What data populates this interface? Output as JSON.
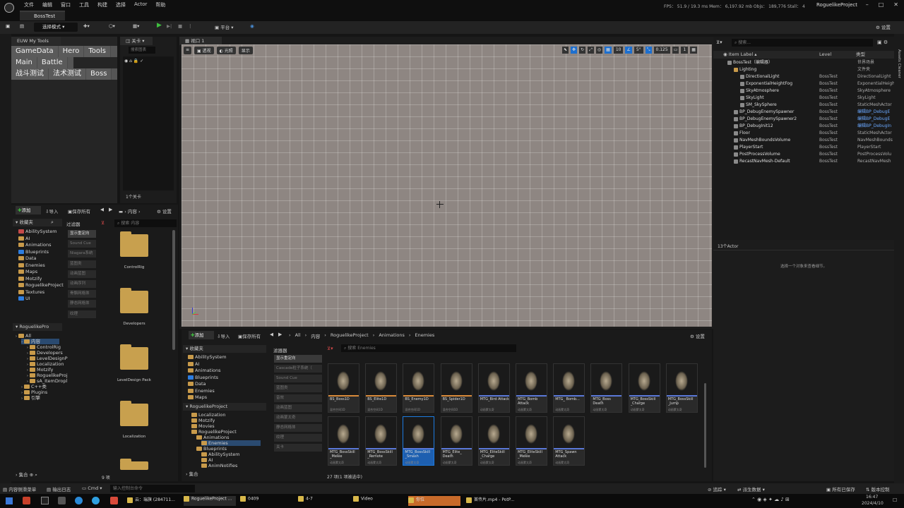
{
  "menubar": {
    "items": [
      "文件",
      "编辑",
      "窗口",
      "工具",
      "构建",
      "选择",
      "Actor",
      "帮助"
    ],
    "tab_title": "BossTest",
    "stats": "FPS： 51.9 / 19.3 ms   Mem： 6,197.92 mb   Objs： 189,776   Stall： 4",
    "project_name": "RoguelikeProject"
  },
  "toolbar": {
    "mode": "选择模式",
    "platform": "平台",
    "settings": "设置"
  },
  "euw": {
    "tab": "EUW My Tools",
    "row1": [
      "GameData",
      "Hero",
      "Tools"
    ],
    "row2": [
      "Main",
      "Battle"
    ],
    "row3": [
      "战斗测试",
      "法术测试",
      "Boss"
    ]
  },
  "layers": {
    "tab": "关卡",
    "search_placeholder": "搜索图表",
    "count": "1个关卡"
  },
  "viewport": {
    "tab": "视口 1",
    "buttons": [
      "透视",
      "光照",
      "显示"
    ],
    "snap_angle": "5°",
    "scale": "0.125",
    "cam_speed": "1",
    "grid_size": "10"
  },
  "left_cb": {
    "add": "添加",
    "import": "导入",
    "save_all": "保存所有",
    "path": "内容",
    "settings": "设置",
    "favorites": "收藏夹",
    "fav_items": [
      "AbilitySystem",
      "AI",
      "Animations",
      "Blueprints",
      "Data",
      "Enemies",
      "Maps",
      "Motzify",
      "RoguelikeProject",
      "Textures",
      "UI"
    ],
    "filter_header": "过滤器",
    "filters": [
      "显示重定向",
      "Sound Cue",
      "Niagara系统",
      "蓝图类",
      "动画蓝图",
      "动画序列",
      "骨骼网格体",
      "静态网格体",
      "纹理"
    ],
    "search_placeholder": "搜索 内容",
    "project_header": "RoguelikePro",
    "tree": [
      "All",
      "内容",
      "ControlRig",
      "Developers",
      "LevelDesignP",
      "Localization",
      "Motzify",
      "RoguelikeProj",
      "sA_ItemDropl",
      "C++类",
      "Plugins",
      "引擎"
    ],
    "folders": [
      "ControlRig",
      "Developers",
      "LevelDesign Pack",
      "Localization"
    ],
    "count": "9 项",
    "collections": "集合"
  },
  "bottom_cb": {
    "add": "添加",
    "import": "导入",
    "save_all": "保存所有",
    "breadcrumb": [
      "All",
      "内容",
      "RoguelikeProject",
      "Animations",
      "Enemies"
    ],
    "settings": "设置",
    "favorites": "收藏夹",
    "fav_items": [
      "AbilitySystem",
      "AI",
      "Animations",
      "Blueprints",
      "Data",
      "Enemies",
      "Maps"
    ],
    "project_header": "RoguelikeProject",
    "tree": [
      "Localization",
      "Motzify",
      "Movies",
      "RoguelikeProject",
      "Animations",
      "Enemies",
      "Blueprints",
      "AbilitySystem",
      "AI",
      "AnimNotifies"
    ],
    "filter_header": "滤器器",
    "filters": [
      "显示重定向",
      "Cascade粒子系统（",
      "Sound Cue",
      "蓝图类",
      "音效",
      "动画蓝图",
      "动画蒙太奇",
      "静态网格体",
      "纹理",
      "关卡"
    ],
    "search_placeholder": "搜索 Enemies",
    "collections": "集合",
    "status": "27 项(1 项被选中)",
    "assets": [
      {
        "name": "BS_Boss1D",
        "type": "混合空间1D",
        "bar": "#d98a3a"
      },
      {
        "name": "BS_Elite1D",
        "type": "混合空间1D",
        "bar": "#d98a3a"
      },
      {
        "name": "BS_Enemy1D",
        "type": "混合空间1D",
        "bar": "#d98a3a"
      },
      {
        "name": "BS_Spider1D",
        "type": "混合空间1D",
        "bar": "#d98a3a"
      },
      {
        "name": "MTG_Bird Attack",
        "type": "动画蒙太奇",
        "bar": "#5a78d8"
      },
      {
        "name": "MTG_Bomb Attack",
        "type": "动画蒙太奇",
        "bar": "#5a78d8"
      },
      {
        "name": "MTG_ Bomb...",
        "type": "动画蒙太奇",
        "bar": "#5a78d8"
      },
      {
        "name": "MTG_Boss Death",
        "type": "动画蒙太奇",
        "bar": "#5a78d8"
      },
      {
        "name": "MTG_BossSkill _Charge",
        "type": "动画蒙太奇",
        "bar": "#5a78d8"
      },
      {
        "name": "MTG_BossSkill _Jump",
        "type": "动画蒙太奇",
        "bar": "#5a78d8"
      },
      {
        "name": "MTG_BossSkill _Melee",
        "type": "动画蒙太奇",
        "bar": "#5a78d8"
      },
      {
        "name": "MTG_BossSkill _Remote",
        "type": "动画蒙太奇",
        "bar": "#5a78d8"
      },
      {
        "name": "MTG_BossSkill _Smash",
        "type": "动画蒙太奇",
        "bar": "#5a78d8"
      },
      {
        "name": "MTG_Elite_ Death",
        "type": "动画蒙太奇",
        "bar": "#5a78d8"
      },
      {
        "name": "MTG_EliteSkill _Charge",
        "type": "动画蒙太奇",
        "bar": "#5a78d8"
      },
      {
        "name": "MTG_EliteSkill _Melee",
        "type": "动画蒙太奇",
        "bar": "#5a78d8"
      },
      {
        "name": "MTG_Spawn Attack",
        "type": "动画蒙太奇",
        "bar": "#5a78d8"
      }
    ]
  },
  "outliner": {
    "search_placeholder": "搜索...",
    "columns": [
      "Item Label",
      "Level",
      "类型"
    ],
    "rows": [
      {
        "label": "BossTest（编辑器）",
        "level": "",
        "type": "世界场景",
        "indent": 0
      },
      {
        "label": "Lighting",
        "level": "",
        "type": "文件夹",
        "indent": 1
      },
      {
        "label": "DirectionalLight",
        "level": "BossTest",
        "type": "DirectionalLight",
        "indent": 2
      },
      {
        "label": "ExponentialHeightFog",
        "level": "BossTest",
        "type": "ExponentialHeightF",
        "indent": 2
      },
      {
        "label": "SkyAtmosphere",
        "level": "BossTest",
        "type": "SkyAtmosphere",
        "indent": 2
      },
      {
        "label": "SkyLight",
        "level": "BossTest",
        "type": "SkyLight",
        "indent": 2
      },
      {
        "label": "SM_SkySphere",
        "level": "BossTest",
        "type": "StaticMeshActor",
        "indent": 2
      },
      {
        "label": "BP_DebugEnemySpawner",
        "level": "BossTest",
        "type": "编辑BP_DebugE",
        "indent": 1
      },
      {
        "label": "BP_DebugEnemySpawner2",
        "level": "BossTest",
        "type": "编辑BP_DebugE",
        "indent": 1
      },
      {
        "label": "BP_DebugInit12",
        "level": "BossTest",
        "type": "编辑BP_DebugIn",
        "indent": 1
      },
      {
        "label": "Floor",
        "level": "BossTest",
        "type": "StaticMeshActor",
        "indent": 1
      },
      {
        "label": "NavMeshBoundsVolume",
        "level": "BossTest",
        "type": "NavMeshBounds",
        "indent": 1
      },
      {
        "label": "PlayerStart",
        "level": "BossTest",
        "type": "PlayerStart",
        "indent": 1
      },
      {
        "label": "PostProcessVolume",
        "level": "BossTest",
        "type": "PostProcessVolu",
        "indent": 1
      },
      {
        "label": "RecastNavMesh-Default",
        "level": "BossTest",
        "type": "RecastNavMesh",
        "indent": 1
      }
    ],
    "actor_count": "13个Actor",
    "details_hint": "选择一个对象来查看细节。"
  },
  "statusbar": {
    "drawer": "内容侧滑菜单",
    "output": "输出日志",
    "cmd": "Cmd",
    "cmd_placeholder": "输入控制台命令",
    "trace": "追踪",
    "derived": "派生数据",
    "save_all": "所有已保存",
    "version": "版本控制"
  },
  "taskbar": {
    "items": [
      "云：瑞旗 (284711...",
      "RoguelikeProject ...",
      "0409",
      "4-7",
      "Video",
      "你位",
      "首传片.mp4 - PotP..."
    ],
    "time": "16:47",
    "date": "2024/4/10"
  },
  "side_tabs": {
    "right": "Assets Cleaner"
  }
}
